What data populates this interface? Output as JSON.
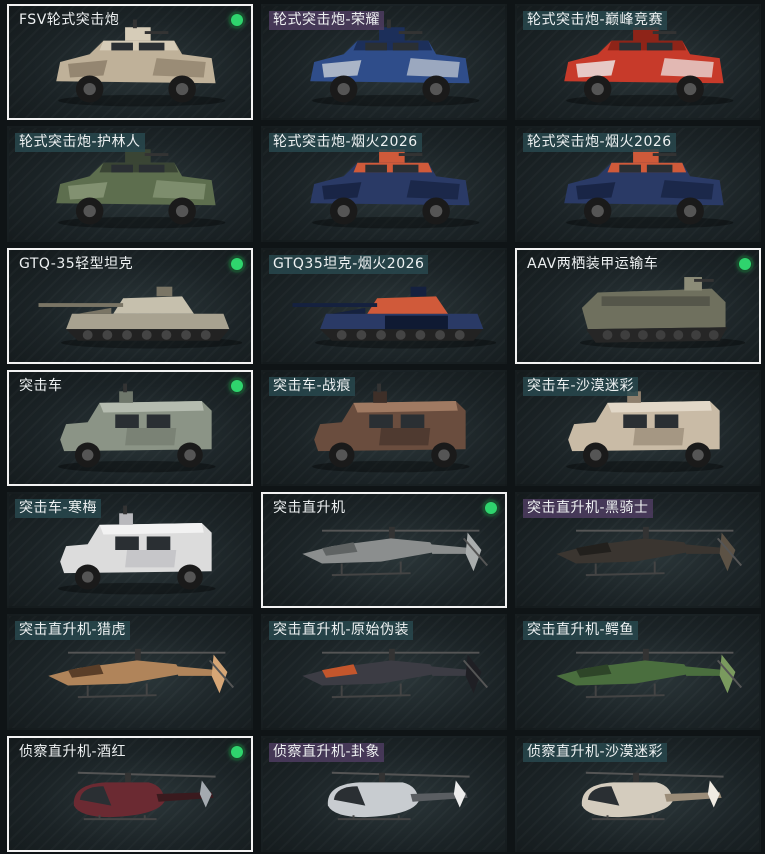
{
  "colors": {
    "selected_border": "#f2f2f2",
    "owned_dot": "#2fd46d",
    "tag_teal": "#28484e",
    "tag_purple": "#4e3c60"
  },
  "vehicles": [
    {
      "name": "FSV轮式突击炮",
      "type": "wheeled",
      "camo": "desert",
      "tag": "none",
      "selected": true,
      "owned": true,
      "icon": "armored-car-icon"
    },
    {
      "name": "轮式突击炮-荣耀",
      "type": "wheeled",
      "camo": "blue",
      "tag": "purple",
      "selected": false,
      "owned": false,
      "icon": "armored-car-icon"
    },
    {
      "name": "轮式突击炮-巅峰竞赛",
      "type": "wheeled",
      "camo": "red",
      "tag": "teal",
      "selected": false,
      "owned": false,
      "icon": "armored-car-icon"
    },
    {
      "name": "轮式突击炮-护林人",
      "type": "wheeled",
      "camo": "green",
      "tag": "teal",
      "selected": false,
      "owned": false,
      "icon": "armored-car-icon"
    },
    {
      "name": "轮式突击炮-烟火2026",
      "type": "wheeled",
      "camo": "firework",
      "tag": "teal",
      "selected": false,
      "owned": false,
      "icon": "armored-car-icon"
    },
    {
      "name": "轮式突击炮-烟火2026",
      "type": "wheeled",
      "camo": "firework",
      "tag": "teal",
      "selected": false,
      "owned": false,
      "icon": "armored-car-icon"
    },
    {
      "name": "GTQ-35轻型坦克",
      "type": "tank",
      "camo": "tan",
      "tag": "none",
      "selected": true,
      "owned": true,
      "icon": "tank-icon"
    },
    {
      "name": "GTQ35坦克-烟火2026",
      "type": "tank2026",
      "camo": "firework",
      "tag": "teal",
      "selected": false,
      "owned": false,
      "icon": "tank-icon"
    },
    {
      "name": "AAV两栖装甲运输车",
      "type": "aav",
      "camo": "olive",
      "tag": "none",
      "selected": true,
      "owned": true,
      "icon": "amphibious-vehicle-icon"
    },
    {
      "name": "突击车",
      "type": "mrap",
      "camo": "greygreen",
      "tag": "none",
      "selected": true,
      "owned": true,
      "icon": "assault-vehicle-icon"
    },
    {
      "name": "突击车-战痕",
      "type": "mrap",
      "camo": "rust",
      "tag": "teal",
      "selected": false,
      "owned": false,
      "icon": "assault-vehicle-icon"
    },
    {
      "name": "突击车-沙漠迷彩",
      "type": "mrap",
      "camo": "sand",
      "tag": "teal",
      "selected": false,
      "owned": false,
      "icon": "assault-vehicle-icon"
    },
    {
      "name": "突击车-寒梅",
      "type": "mrap",
      "camo": "white",
      "tag": "teal",
      "selected": false,
      "owned": false,
      "icon": "assault-vehicle-icon"
    },
    {
      "name": "突击直升机",
      "type": "heli",
      "camo": "grey",
      "tag": "none",
      "selected": true,
      "owned": true,
      "icon": "attack-helicopter-icon"
    },
    {
      "name": "突击直升机-黑骑士",
      "type": "heli",
      "camo": "black",
      "tag": "purple",
      "selected": false,
      "owned": false,
      "icon": "attack-helicopter-icon"
    },
    {
      "name": "突击直升机-猎虎",
      "type": "heli",
      "camo": "tiger",
      "tag": "teal",
      "selected": false,
      "owned": false,
      "icon": "attack-helicopter-icon"
    },
    {
      "name": "突击直升机-原始伪装",
      "type": "heli",
      "camo": "tribal",
      "tag": "teal",
      "selected": false,
      "owned": false,
      "icon": "attack-helicopter-icon"
    },
    {
      "name": "突击直升机-鳄鱼",
      "type": "heli",
      "camo": "croc",
      "tag": "teal",
      "selected": false,
      "owned": false,
      "icon": "attack-helicopter-icon"
    },
    {
      "name": "侦察直升机-酒红",
      "type": "scout",
      "camo": "wine",
      "tag": "none",
      "selected": true,
      "owned": true,
      "icon": "scout-helicopter-icon"
    },
    {
      "name": "侦察直升机-卦象",
      "type": "scout",
      "camo": "silver",
      "tag": "purple",
      "selected": false,
      "owned": false,
      "icon": "scout-helicopter-icon"
    },
    {
      "name": "侦察直升机-沙漠迷彩",
      "type": "scout",
      "camo": "sandcamo",
      "tag": "teal",
      "selected": false,
      "owned": false,
      "icon": "scout-helicopter-icon"
    }
  ]
}
